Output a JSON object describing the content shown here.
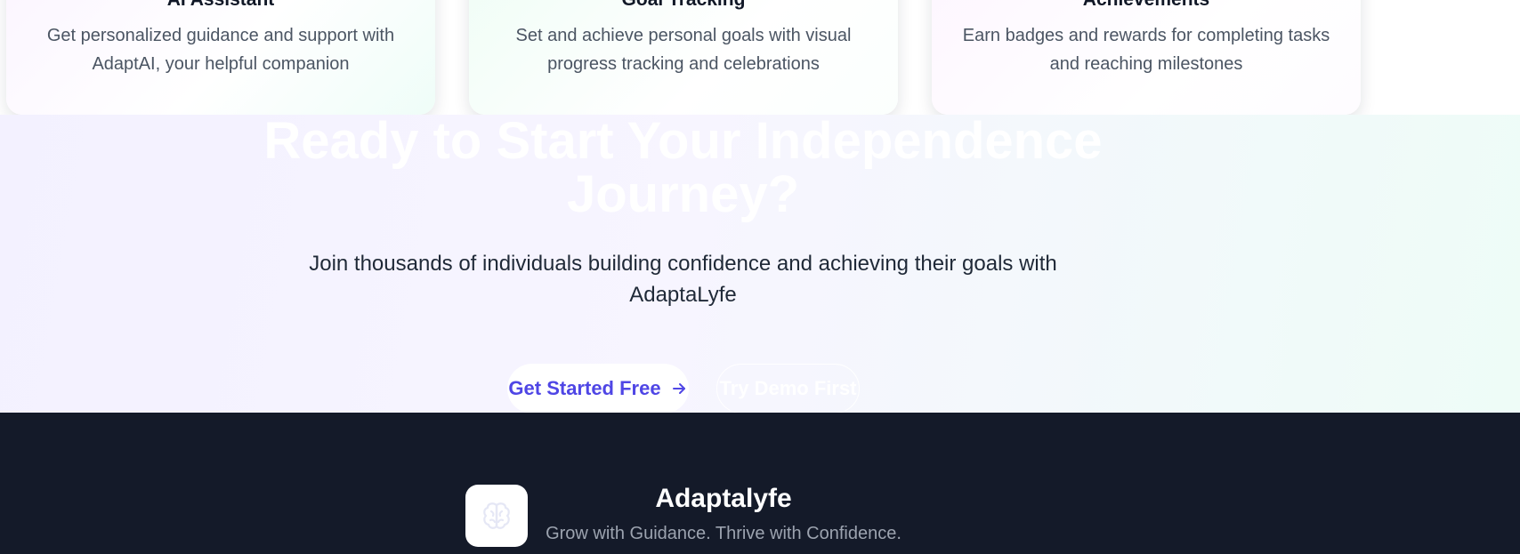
{
  "features": {
    "cards": [
      {
        "title": "AI Assistant",
        "description": "Get personalized guidance and support with AdaptAI, your helpful companion"
      },
      {
        "title": "Goal Tracking",
        "description": "Set and achieve personal goals with visual progress tracking and celebrations"
      },
      {
        "title": "Achievements",
        "description": "Earn badges and rewards for completing tasks and reaching milestones"
      }
    ]
  },
  "cta": {
    "title": "Ready to Start Your Independence Journey?",
    "subtitle": "Join thousands of individuals building confidence and achieving their goals with AdaptaLyfe",
    "primary_button": {
      "label": "Get Started Free",
      "icon": "arrow-right-icon"
    },
    "secondary_button": {
      "label": "Try Demo First"
    }
  },
  "footer": {
    "logo_icon": "brain-icon",
    "brand_name": "Adaptalyfe",
    "tagline": "Grow with Guidance. Thrive with Confidence."
  },
  "colors": {
    "accent": "#4f46e5",
    "footer_background": "#141a29",
    "tagline": "#9ca3af"
  }
}
